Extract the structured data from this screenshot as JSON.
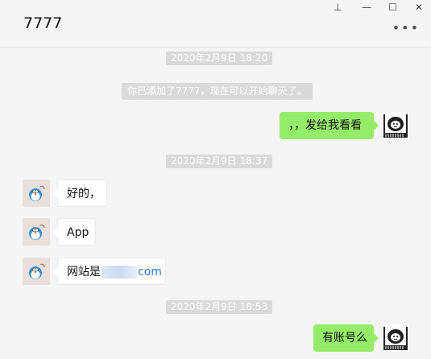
{
  "window": {
    "title": "7777",
    "pin_glyph": "⊥",
    "minimize_glyph": "—",
    "maximize_glyph": "☐",
    "close_glyph": "✕",
    "more_glyph": "•••"
  },
  "chat": {
    "times": [
      "2020年2月9日 18:20",
      "2020年2月9日 18:37",
      "2020年2月9日 18:53"
    ],
    "system_message": "你已添加了7777，现在可以开始聊天了。",
    "messages": [
      {
        "side": "right",
        "text": "，，发给我看看"
      },
      {
        "side": "left",
        "text": "好的，"
      },
      {
        "side": "left",
        "text": "App"
      },
      {
        "side": "left",
        "text_prefix": "网站是",
        "text_suffix": "com"
      },
      {
        "side": "right",
        "text": "有账号么"
      }
    ]
  },
  "colors": {
    "background": "#f5f5f5",
    "bubble_self": "#95ec69",
    "bubble_other": "#ffffff",
    "timestamp_bg": "#dadada",
    "link": "#2b73d8"
  }
}
